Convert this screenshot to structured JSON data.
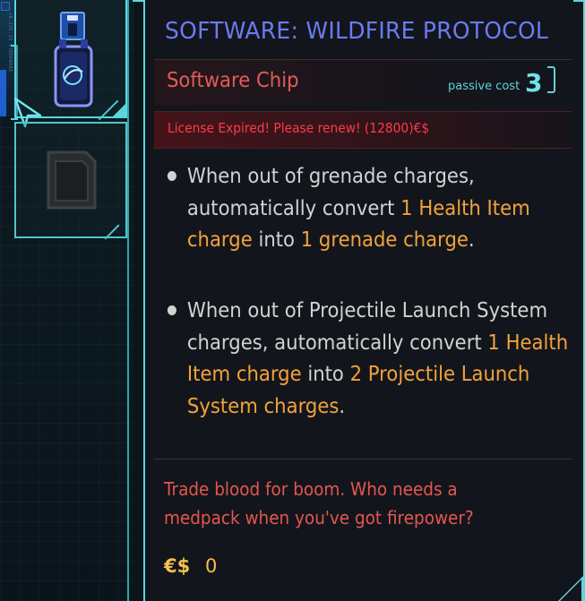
{
  "item": {
    "title": "SOFTWARE: WILDFIRE PROTOCOL",
    "type": "Software Chip",
    "passive_cost_label": "passive cost",
    "passive_cost_value": "3",
    "warning": "License Expired! Please renew! (12800)€$",
    "effects": [
      {
        "parts": [
          {
            "text": "When out of grenade charges, automatically convert ",
            "highlight": false
          },
          {
            "text": "1 Health Item charge",
            "highlight": true
          },
          {
            "text": " into ",
            "highlight": false
          },
          {
            "text": "1 grenade charge",
            "highlight": true
          },
          {
            "text": ".",
            "highlight": false
          }
        ]
      },
      {
        "parts": [
          {
            "text": "When out of Projectile Launch System charges, automatically convert ",
            "highlight": false
          },
          {
            "text": "1 Health Item charge",
            "highlight": true
          },
          {
            "text": " into ",
            "highlight": false
          },
          {
            "text": "2 Projectile Launch System charges",
            "highlight": true
          },
          {
            "text": ".",
            "highlight": false
          }
        ]
      }
    ],
    "flavor_text": "Trade blood for boom. Who needs a medpack when you've got firepower?",
    "price_symbol": "€$",
    "price_value": "0"
  },
  "sidebar": {
    "tiny_text": "v0.295.33 CYBERWARE",
    "slots": [
      {
        "icon": "software-shard-icon",
        "selected": true
      },
      {
        "icon": "empty-chip-slot-icon",
        "selected": false
      }
    ]
  },
  "colors": {
    "accent_cyan": "#5bd6dd",
    "title_blue": "#6a7cf0",
    "red": "#e35b58",
    "warning_red": "#ff3a48",
    "highlight_orange": "#f2a33a",
    "price_gold": "#f2c14a"
  }
}
